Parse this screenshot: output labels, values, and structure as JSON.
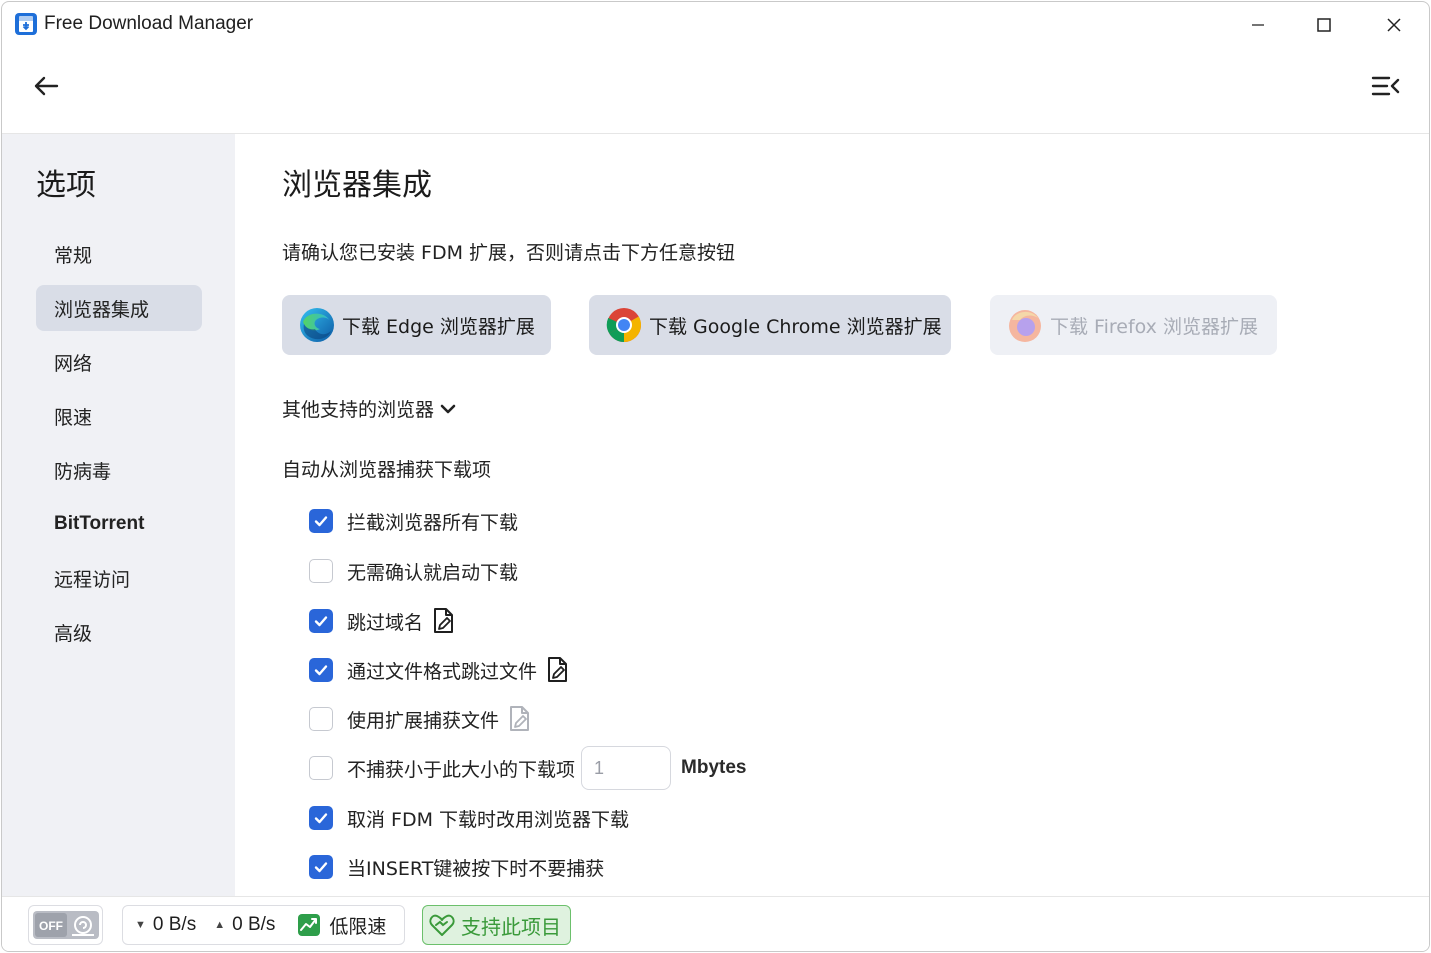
{
  "window": {
    "title": "Free Download Manager"
  },
  "sidebar": {
    "title": "选项",
    "items": [
      {
        "label": "常规"
      },
      {
        "label": "浏览器集成"
      },
      {
        "label": "网络"
      },
      {
        "label": "限速"
      },
      {
        "label": "防病毒"
      },
      {
        "label": "BitTorrent"
      },
      {
        "label": "远程访问"
      },
      {
        "label": "高级"
      }
    ],
    "active_index": 1
  },
  "content": {
    "title": "浏览器集成",
    "hint": "请确认您已安装 FDM 扩展，否则请点击下方任意按钮",
    "buttons": {
      "edge": "下载 Edge 浏览器扩展",
      "chrome": "下载 Google Chrome 浏览器扩展",
      "firefox": "下载 Firefox 浏览器扩展"
    },
    "other_browsers": "其他支持的浏览器",
    "auto_capture": "自动从浏览器捕获下载项",
    "options": [
      {
        "label": "拦截浏览器所有下载",
        "checked": true
      },
      {
        "label": "无需确认就启动下载",
        "checked": false
      },
      {
        "label": "跳过域名",
        "checked": true
      },
      {
        "label": "通过文件格式跳过文件",
        "checked": true
      },
      {
        "label": "使用扩展捕获文件",
        "checked": false
      },
      {
        "label": "不捕获小于此大小的下载项",
        "checked": false
      },
      {
        "label": "取消 FDM 下载时改用浏览器下载",
        "checked": true
      },
      {
        "label": "当INSERT键被按下时不要捕获",
        "checked": true
      }
    ],
    "min_size": {
      "value": "1",
      "unit": "Mbytes"
    }
  },
  "statusbar": {
    "off_label": "OFF",
    "download_speed": "0 B/s",
    "upload_speed": "0 B/s",
    "speed_mode": "低限速",
    "support": "支持此项目"
  },
  "colors": {
    "accent": "#2a66d9",
    "sidebar_bg": "#f0f1f5",
    "active_item": "#d9dde7",
    "support_green": "#3a9a3a"
  }
}
